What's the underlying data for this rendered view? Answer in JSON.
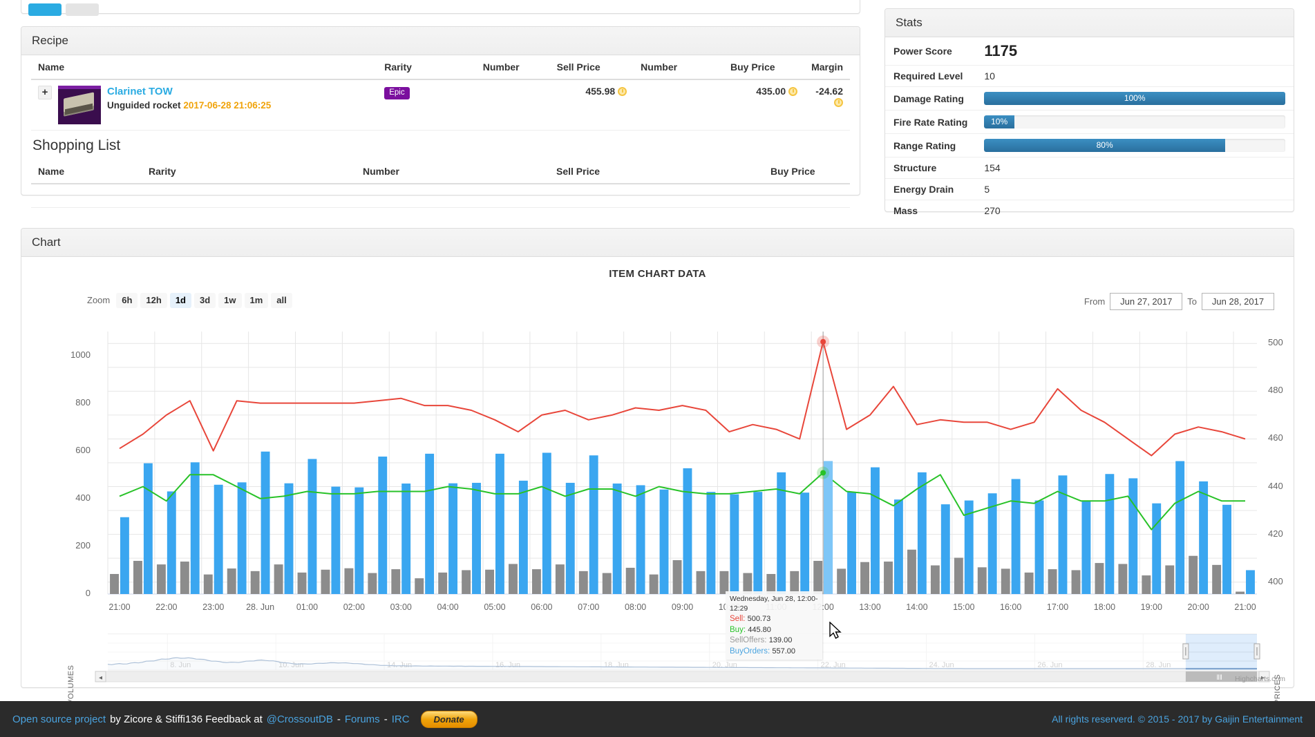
{
  "recipe": {
    "panel_title": "Recipe",
    "columns": [
      "Name",
      "Rarity",
      "Number",
      "Sell Price",
      "Number",
      "Buy Price",
      "Margin"
    ],
    "rows": [
      {
        "expander": "+",
        "name": "Clarinet TOW",
        "subtitle": "Unguided rocket",
        "date": "2017-06-28 21:06:25",
        "rarity": "Epic",
        "number_sell": "",
        "sell_price": "455.98",
        "number_buy": "",
        "buy_price": "435.00",
        "margin": "-24.62"
      }
    ]
  },
  "shopping_list": {
    "title": "Shopping List",
    "columns": [
      "Name",
      "Rarity",
      "Number",
      "Sell Price",
      "Buy Price"
    ],
    "rows": []
  },
  "stats": {
    "panel_title": "Stats",
    "rows": [
      {
        "label": "Power Score",
        "type": "big",
        "value": "1175"
      },
      {
        "label": "Required Level",
        "type": "text",
        "value": "10"
      },
      {
        "label": "Damage Rating",
        "type": "progress",
        "value": "100%",
        "percent": 100
      },
      {
        "label": "Fire Rate Rating",
        "type": "progress",
        "value": "10%",
        "percent": 10
      },
      {
        "label": "Range Rating",
        "type": "progress",
        "value": "80%",
        "percent": 80
      },
      {
        "label": "Structure",
        "type": "text",
        "value": "154"
      },
      {
        "label": "Energy Drain",
        "type": "text",
        "value": "5"
      },
      {
        "label": "Mass",
        "type": "text",
        "value": "270"
      }
    ]
  },
  "chart_panel": {
    "panel_title": "Chart"
  },
  "chart_controls": {
    "zoom_label": "Zoom",
    "ranges": [
      {
        "label": "6h",
        "selected": false
      },
      {
        "label": "12h",
        "selected": false
      },
      {
        "label": "1d",
        "selected": true
      },
      {
        "label": "3d",
        "selected": false
      },
      {
        "label": "1w",
        "selected": false
      },
      {
        "label": "1m",
        "selected": false
      },
      {
        "label": "all",
        "selected": false
      }
    ],
    "from_label": "From",
    "from_value": "Jun 27, 2017",
    "to_label": "To",
    "to_value": "Jun 28, 2017",
    "credit": "Highcharts.com"
  },
  "tooltip": {
    "header": "Wednesday, Jun 28, 12:00-12:29",
    "rows": [
      {
        "key": "Sell:",
        "value": "500.73",
        "color": "#e8463a"
      },
      {
        "key": "Buy:",
        "value": "445.80",
        "color": "#28c228"
      },
      {
        "key": "SellOffers:",
        "value": "139.00",
        "color": "#9b9b9b"
      },
      {
        "key": "BuyOrders:",
        "value": "557.00",
        "color": "#4aa3df"
      }
    ]
  },
  "chart_data": {
    "type": "line",
    "title": "ITEM CHART DATA",
    "xlabel": "",
    "ylabel": "VOLUMES",
    "y2label": "PRICES",
    "ylim": [
      0,
      1100
    ],
    "y2lim": [
      395,
      505
    ],
    "yticks": [
      0,
      200,
      400,
      600,
      800,
      1000
    ],
    "y2ticks": [
      400,
      420,
      440,
      460,
      480,
      500
    ],
    "grid": true,
    "legend": "none",
    "x": [
      "21:00",
      "21:30",
      "22:00",
      "22:30",
      "23:00",
      "23:30",
      "28. Jun",
      "00:30",
      "01:00",
      "01:30",
      "02:00",
      "02:30",
      "03:00",
      "03:30",
      "04:00",
      "04:30",
      "05:00",
      "05:30",
      "06:00",
      "06:30",
      "07:00",
      "07:30",
      "08:00",
      "08:30",
      "09:00",
      "09:30",
      "10:00",
      "10:30",
      "11:00",
      "11:30",
      "12:00",
      "12:30",
      "13:00",
      "13:30",
      "14:00",
      "14:30",
      "15:00",
      "15:30",
      "16:00",
      "16:30",
      "17:00",
      "17:30",
      "18:00",
      "18:30",
      "19:00",
      "19:30",
      "20:00",
      "20:30",
      "21:00"
    ],
    "xticks": [
      "21:00",
      "22:00",
      "23:00",
      "28. Jun",
      "01:00",
      "02:00",
      "03:00",
      "04:00",
      "05:00",
      "06:00",
      "07:00",
      "08:00",
      "09:00",
      "10:00",
      "11:00",
      "12:00",
      "13:00",
      "14:00",
      "15:00",
      "16:00",
      "17:00",
      "18:00",
      "19:00",
      "20:00",
      "21:00"
    ],
    "series": [
      {
        "name": "Sell",
        "type": "line",
        "axis": "right",
        "color": "#e8463a",
        "values": [
          456,
          462,
          470,
          476,
          455,
          476,
          475,
          475,
          475,
          475,
          475,
          476,
          477,
          474,
          474,
          472,
          468,
          463,
          470,
          472,
          468,
          470,
          473,
          472,
          474,
          472,
          463,
          466,
          464,
          460,
          500.73,
          464,
          470,
          482,
          466,
          468,
          467,
          467,
          464,
          467,
          481,
          472,
          467,
          460,
          453,
          462,
          465,
          463,
          460
        ]
      },
      {
        "name": "Buy",
        "type": "line",
        "axis": "right",
        "color": "#28c228",
        "values": [
          436,
          440,
          434,
          445,
          445,
          440,
          435,
          436,
          438,
          437,
          437,
          438,
          438,
          438,
          440,
          439,
          437,
          437,
          440,
          436,
          439,
          439,
          436,
          440,
          438,
          437,
          437,
          438,
          439,
          437,
          445.8,
          438,
          437,
          432,
          439,
          445,
          428,
          431,
          434,
          433,
          438,
          434,
          434,
          436,
          422,
          433,
          438,
          434,
          434
        ]
      },
      {
        "name": "BuyOrders",
        "type": "column",
        "axis": "left",
        "color": "#3aa6f0",
        "values": [
          322,
          548,
          430,
          552,
          458,
          468,
          597,
          464,
          566,
          450,
          447,
          576,
          463,
          588,
          464,
          466,
          588,
          475,
          592,
          466,
          581,
          463,
          456,
          438,
          527,
          428,
          418,
          428,
          510,
          425,
          557,
          428,
          531,
          396,
          510,
          376,
          392,
          422,
          482,
          392,
          497,
          388,
          503,
          485,
          380,
          557,
          472,
          374,
          100
        ]
      },
      {
        "name": "SellOffers",
        "type": "column",
        "axis": "left",
        "color": "#8c8c8c",
        "values": [
          84,
          139,
          124,
          136,
          82,
          107,
          96,
          124,
          90,
          102,
          108,
          88,
          104,
          66,
          90,
          100,
          102,
          126,
          104,
          124,
          96,
          88,
          110,
          82,
          142,
          96,
          96,
          88,
          84,
          96,
          139,
          106,
          134,
          136,
          186,
          120,
          152,
          112,
          106,
          90,
          104,
          100,
          130,
          126,
          78,
          120,
          160,
          122,
          10
        ]
      }
    ],
    "navigator": {
      "xticks": [
        "8. Jun",
        "10. Jun",
        "14. Jun",
        "16. Jun",
        "18. Jun",
        "20. Jun",
        "22. Jun",
        "24. Jun",
        "26. Jun",
        "28. Jun"
      ],
      "selection": "28. Jun"
    }
  },
  "footer": {
    "link1": "Open source project",
    "text1": "by Zicore & Stiffi136 Feedback at",
    "link2": "@CrossoutDB",
    "dash1": "-",
    "link3": "Forums",
    "dash2": "-",
    "link4": "IRC",
    "donate": "Donate",
    "rights": "All rights reserverd. © 2015 - 2017 by Gaijin Entertainment"
  }
}
